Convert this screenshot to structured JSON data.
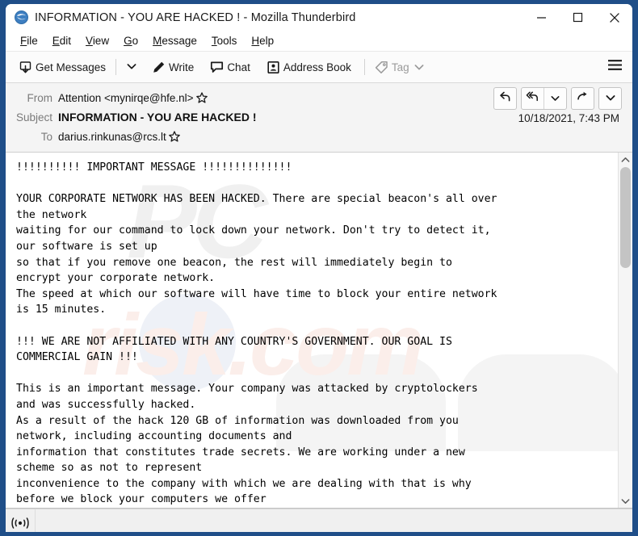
{
  "window": {
    "title": "INFORMATION - YOU ARE HACKED ! - Mozilla Thunderbird",
    "app_icon": "thunderbird-icon",
    "controls": {
      "minimize": "minimize-icon",
      "maximize": "maximize-icon",
      "close": "close-icon"
    },
    "border_color": "#1f4e88"
  },
  "menubar": {
    "items": [
      {
        "label": "File",
        "accesskey": "F"
      },
      {
        "label": "Edit",
        "accesskey": "E"
      },
      {
        "label": "View",
        "accesskey": "V"
      },
      {
        "label": "Go",
        "accesskey": "G"
      },
      {
        "label": "Message",
        "accesskey": "M"
      },
      {
        "label": "Tools",
        "accesskey": "T"
      },
      {
        "label": "Help",
        "accesskey": "H"
      }
    ]
  },
  "toolbar": {
    "get_messages_label": "Get Messages",
    "get_messages_icon": "download-inbox-icon",
    "get_messages_caret": "chevron-down-icon",
    "write_label": "Write",
    "write_icon": "pencil-icon",
    "chat_label": "Chat",
    "chat_icon": "speech-bubble-icon",
    "address_book_label": "Address Book",
    "address_book_icon": "contact-card-icon",
    "tag_label": "Tag",
    "tag_icon": "tag-icon",
    "tag_caret": "chevron-down-icon",
    "tag_disabled": true,
    "app_menu_icon": "hamburger-menu-icon"
  },
  "message_header": {
    "from_label": "From",
    "from_value": "Attention <mynirqe@hfe.nl>",
    "subject_label": "Subject",
    "subject_value": "INFORMATION - YOU ARE HACKED !",
    "to_label": "To",
    "to_value": "darius.rinkunas@rcs.lt",
    "date": "10/18/2021, 7:43 PM",
    "star_icon": "star-outline-icon",
    "actions": {
      "reply": "reply-icon",
      "reply_all": "reply-all-icon",
      "reply_all_caret": "chevron-down-icon",
      "forward": "forward-arrow-icon",
      "more": "chevron-down-icon"
    }
  },
  "message_body": {
    "text": "!!!!!!!!!! IMPORTANT MESSAGE !!!!!!!!!!!!!!\n\nYOUR CORPORATE NETWORK HAS BEEN HACKED. There are special beacon's all over\nthe network\nwaiting for our command to lock down your network. Don't try to detect it,\nour software is set up\nso that if you remove one beacon, the rest will immediately begin to\nencrypt your corporate network.\nThe speed at which our software will have time to block your entire network\nis 15 minutes.\n\n!!! WE ARE NOT AFFILIATED WITH ANY COUNTRY'S GOVERNMENT. OUR GOAL IS\nCOMMERCIAL GAIN !!!\n\nThis is an important message. Your company was attacked by cryptolockers\nand was successfully hacked.\nAs a result of the hack 120 GB of information was downloaded from you\nnetwork, including accounting documents and\ninformation that constitutes trade secrets. We are working under a new\nscheme so as not to represent\ninconvenience to the company with which we are dealing with that is why\nbefore we block your computers we offer",
    "watermark_pc": "PC",
    "watermark_risk": "risk.com",
    "scrollbar": {
      "up_icon": "chevron-up-icon",
      "down_icon": "chevron-down-icon",
      "thumb": "scrollbar-thumb"
    }
  },
  "statusbar": {
    "icon": "connection-status-icon",
    "text": ""
  }
}
